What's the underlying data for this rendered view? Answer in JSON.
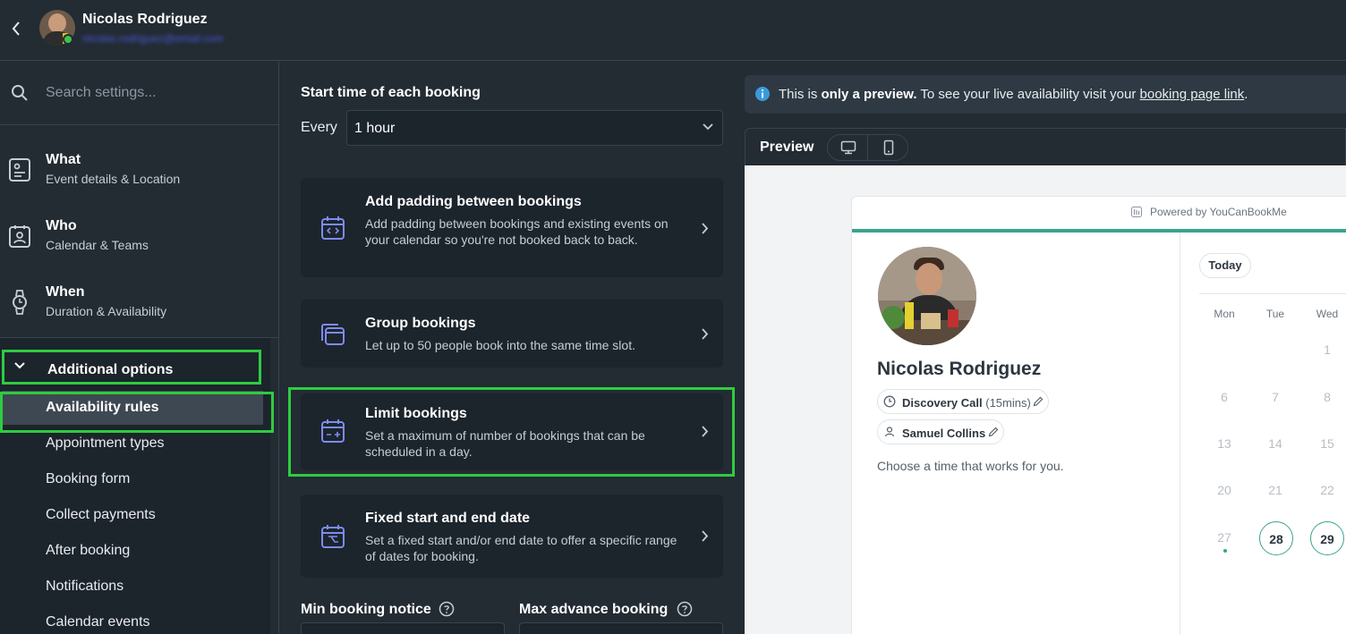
{
  "header": {
    "user_name": "Nicolas Rodriguez",
    "user_email": "nicolas.rodriguez@email.com"
  },
  "sidebar": {
    "search_placeholder": "Search settings...",
    "nav": [
      {
        "title": "What",
        "subtitle": "Event details & Location",
        "icon": "details-icon"
      },
      {
        "title": "Who",
        "subtitle": "Calendar & Teams",
        "icon": "contact-icon"
      },
      {
        "title": "When",
        "subtitle": "Duration & Availability",
        "icon": "watch-icon"
      }
    ],
    "section_label": "Additional options",
    "sub_items": [
      "Availability rules",
      "Appointment types",
      "Booking form",
      "Collect payments",
      "After booking",
      "Notifications",
      "Calendar events"
    ]
  },
  "main": {
    "start_time_title": "Start time of each booking",
    "every_label": "Every",
    "interval_value": "1 hour",
    "cards": [
      {
        "title": "Add padding between bookings",
        "desc": "Add padding between bookings and existing events on your calendar so you're not booked back to back.",
        "icon": "calendar-code-icon"
      },
      {
        "title": "Group bookings",
        "desc": "Let up to 50 people book into the same time slot.",
        "icon": "stacked-calendars-icon"
      },
      {
        "title": "Limit bookings",
        "desc": "Set a maximum of number of bookings that can be scheduled in a day.",
        "icon": "calendar-limit-icon"
      },
      {
        "title": "Fixed start and end date",
        "desc": "Set a fixed start and/or end date to offer a specific range of dates for booking.",
        "icon": "calendar-range-icon"
      }
    ],
    "min_notice_label": "Min booking notice",
    "max_advance_label": "Max advance booking"
  },
  "preview": {
    "info_pre": "This is ",
    "info_bold": "only a preview.",
    "info_mid": " To see your live availability visit your ",
    "info_link": "booking page link",
    "info_end": ".",
    "label": "Preview",
    "powered_by": "Powered by YouCanBookMe",
    "name": "Nicolas Rodriguez",
    "event_name": "Discovery Call",
    "event_duration": "(15mins)",
    "team_member": "Samuel Collins",
    "choose_text": "Choose a time that works for you.",
    "today_label": "Today",
    "weekdays": [
      "Mon",
      "Tue",
      "Wed"
    ],
    "days": [
      [
        "",
        "",
        "1"
      ],
      [
        "6",
        "7",
        "8"
      ],
      [
        "13",
        "14",
        "15"
      ],
      [
        "20",
        "21",
        "22"
      ],
      [
        "27",
        "28",
        "29"
      ]
    ],
    "available_days": [
      "28",
      "29"
    ],
    "accent_color": "#3aa390"
  }
}
